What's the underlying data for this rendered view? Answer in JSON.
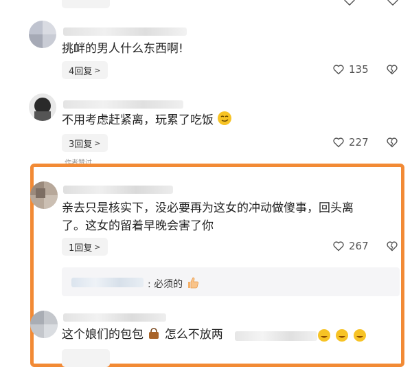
{
  "comments": [
    {
      "text": "挑衅的男人什么东西啊!",
      "reply_label": "4回复",
      "likes": "135"
    },
    {
      "text": "不用考虑赶紧离，玩累了吃饭",
      "reply_label": "3回复",
      "likes": "227"
    },
    {
      "author_tag": "作者赞过",
      "text_line1": "亲去只是核实下，没必要再为这女的冲动做傻事，回头离",
      "text_line2": "了。这女的留着早晚会害了你",
      "reply_label": "1回复",
      "likes": "267",
      "sub_reply": ": 必须的"
    },
    {
      "text_start": "这个娘们的包包",
      "text_end": "怎么不放两"
    }
  ],
  "icons": {
    "like": "heart-outline-icon",
    "dislike": "heart-broken-outline-icon",
    "chevron": "chevron-right-icon",
    "emoji_smirk": "smirk-emoji-icon",
    "emoji_thumb": "thumbs-up-emoji-icon",
    "emoji_bag": "handbag-emoji-icon"
  },
  "colors": {
    "highlight_border": "#f28a35"
  }
}
